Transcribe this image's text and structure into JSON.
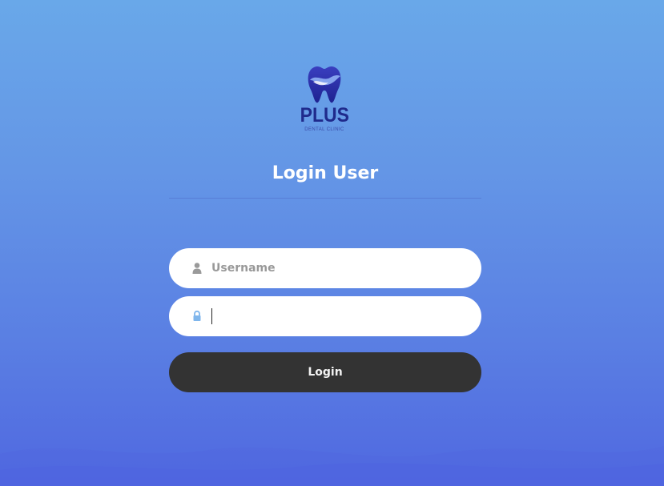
{
  "logo": {
    "brand": "PLUS",
    "subtitle": "DENTAL CLINIC",
    "icon": "tooth-icon"
  },
  "form": {
    "title": "Login User",
    "username": {
      "placeholder": "Username",
      "value": "",
      "icon": "user-icon"
    },
    "password": {
      "placeholder": "",
      "value": "",
      "icon": "lock-icon"
    },
    "submit_label": "Login"
  },
  "colors": {
    "bg_top": "#69a8e9",
    "bg_bottom": "#5068e0",
    "button": "#333333",
    "logo_primary": "#2a2f9c",
    "lock_icon": "#7fb6ec",
    "user_icon": "#9a9a9a"
  }
}
